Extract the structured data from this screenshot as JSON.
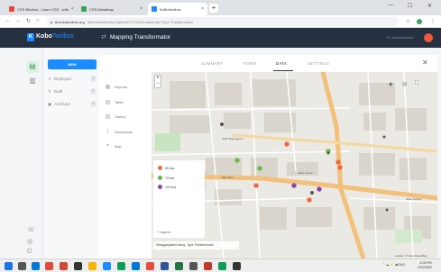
{
  "browser": {
    "tabs": [
      {
        "label": "CSS Bbutton - Learn CSS - w3s",
        "active": false
      },
      {
        "label": "CSS Modalbap",
        "active": false
      },
      {
        "label": "KoBo/toolbox",
        "active": true
      }
    ],
    "url_secure": "kf.kobotoolbox.org",
    "url_path": "/#/forms/aKnbEwXhjMzAHVTD5xG/data/map?Type Transformator"
  },
  "app": {
    "logo_letter": "K",
    "logo_bold": "Kobo",
    "logo_thin": "Toolbox",
    "title": "Mapping Transformator",
    "user": "Hi, administration"
  },
  "sidebar": {
    "new_button": "NEW",
    "items": [
      {
        "label": "Deployed",
        "count": "1"
      },
      {
        "label": "Draft",
        "count": "0"
      },
      {
        "label": "Archived",
        "count": "0"
      }
    ]
  },
  "form_tabs": [
    "SUMMARY",
    "FORM",
    "DATA",
    "SETTINGS"
  ],
  "active_tab": "DATA",
  "data_views": [
    {
      "label": "Reports",
      "icon": "reports-icon"
    },
    {
      "label": "Table",
      "icon": "table-icon"
    },
    {
      "label": "Gallery",
      "icon": "gallery-icon"
    },
    {
      "label": "Downloads",
      "icon": "downloads-icon"
    },
    {
      "label": "Map",
      "icon": "map-icon"
    }
  ],
  "map": {
    "legend": [
      {
        "label": "50 kva",
        "color": "#ef6a3f"
      },
      {
        "label": "75 kva",
        "color": "#66bb44"
      },
      {
        "label": "100 kva",
        "color": "#8e44ad"
      }
    ],
    "legend_toggle": "Legend",
    "footer": "Disaggregated using: Type Transformator",
    "street_labels": [
      "Jalan Diponegoro",
      "Jalan Baru",
      "Jalan Kenari",
      "Jalan Suroso"
    ],
    "attribution": "Leaflet | © OpenStreetMap"
  },
  "taskbar": {
    "lang": "ENG",
    "time": "4:03 PM",
    "date": "1/22/2020"
  }
}
